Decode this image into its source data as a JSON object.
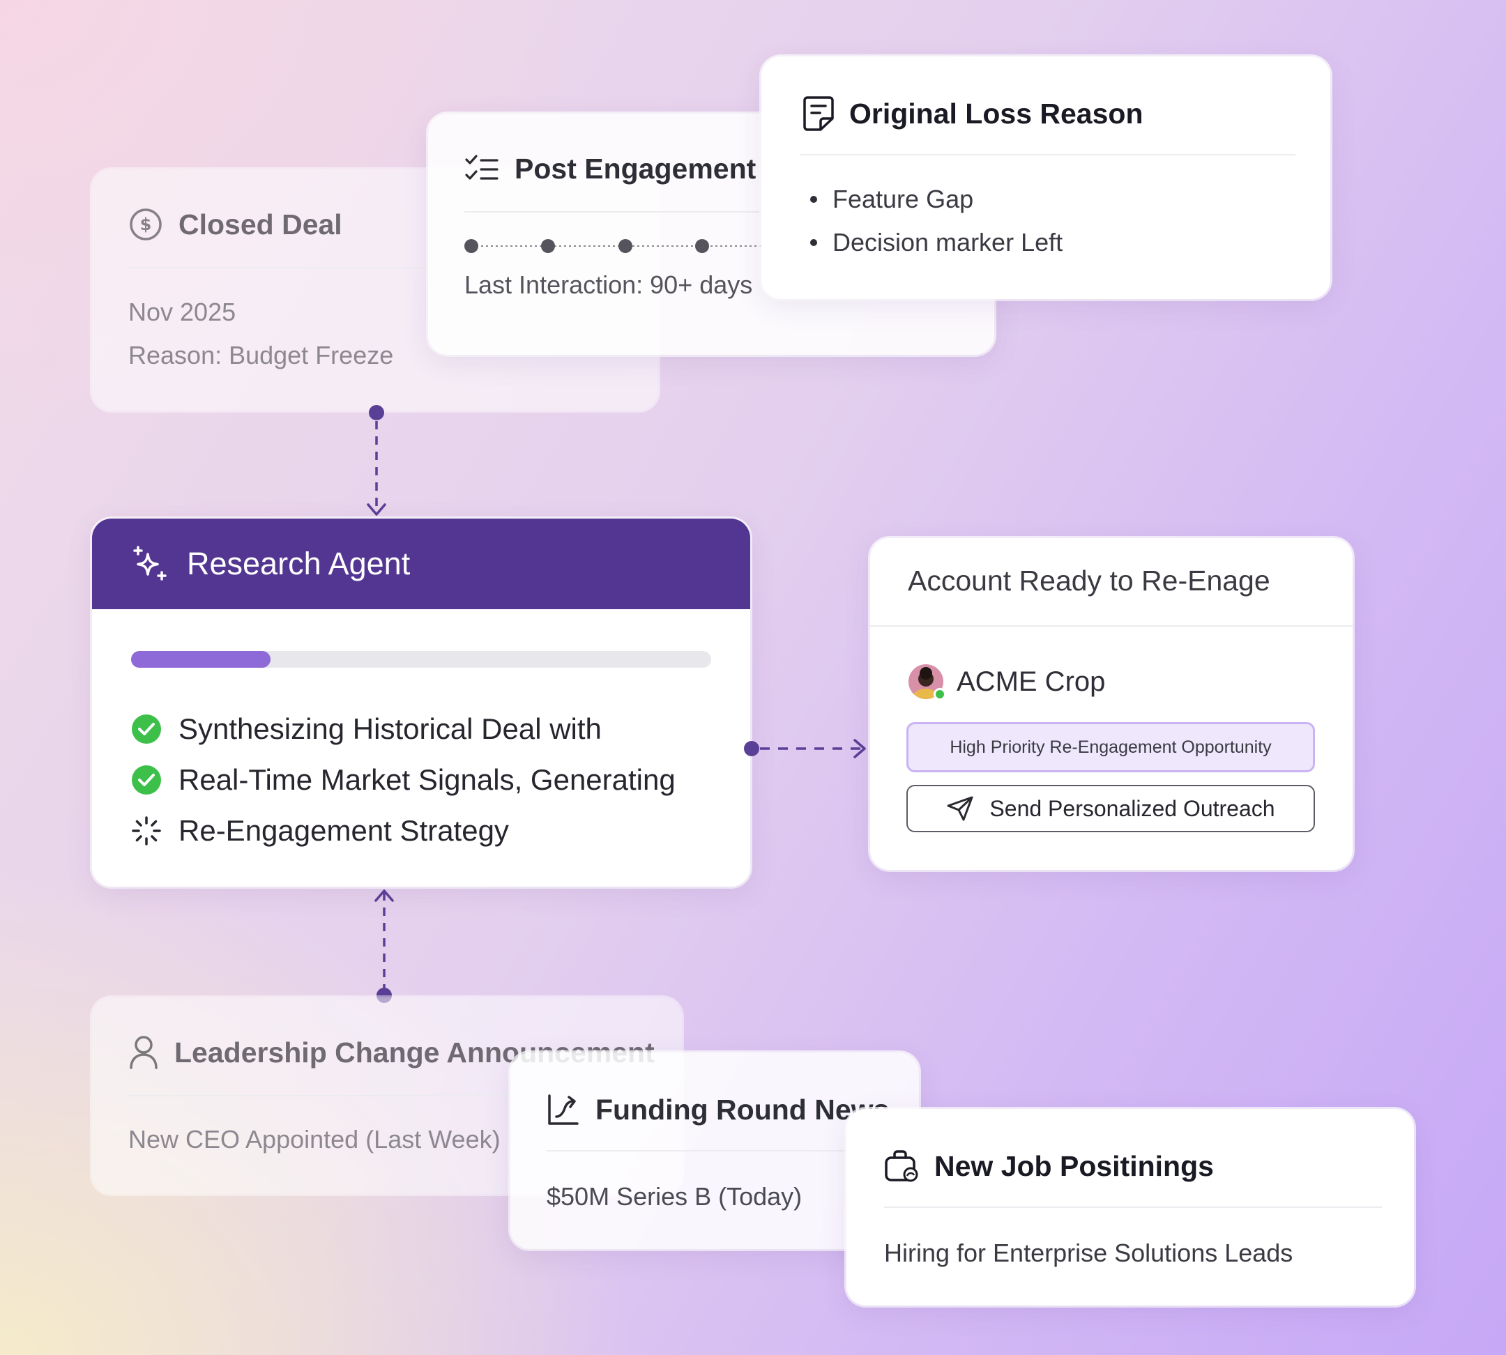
{
  "closed_deal": {
    "icon": "dollar-circle-icon",
    "title": "Closed Deal",
    "date": "Nov 2025",
    "reason": "Reason: Budget Freeze"
  },
  "post_engagement": {
    "icon": "checklist-icon",
    "title": "Post Engagement",
    "last_interaction": "Last Interaction: 90+ days"
  },
  "loss_reason": {
    "icon": "note-icon",
    "title": "Original Loss Reason",
    "items": [
      "Feature Gap",
      "Decision marker Left"
    ]
  },
  "research_agent": {
    "icon": "sparkles-icon",
    "title": "Research Agent",
    "progress": 0.24,
    "steps": [
      {
        "label": "Synthesizing Historical Deal with",
        "status": "done"
      },
      {
        "label": "Real-Time Market Signals, Generating",
        "status": "done"
      },
      {
        "label": "Re-Engagement Strategy",
        "status": "loading"
      }
    ]
  },
  "account": {
    "title": "Account Ready to Re-Enage",
    "company": "ACME Crop",
    "badge": "High Priority Re-Engagement Opportunity",
    "outreach_button": "Send Personalized Outreach",
    "outreach_icon": "send-icon"
  },
  "leadership": {
    "icon": "user-icon",
    "title": "Leadership Change Announcement",
    "detail": "New CEO Appointed (Last Week)"
  },
  "funding": {
    "icon": "growth-chart-icon",
    "title": "Funding Round News",
    "detail": "$50M Series B (Today)"
  },
  "jobs": {
    "icon": "briefcase-icon",
    "title": "New Job Positinings",
    "detail": "Hiring for Enterprise Solutions Leads"
  },
  "colors": {
    "accent": "#533592",
    "progress_fill": "#8e6ad8",
    "success": "#3cc04a",
    "connector": "#5a3f96"
  }
}
